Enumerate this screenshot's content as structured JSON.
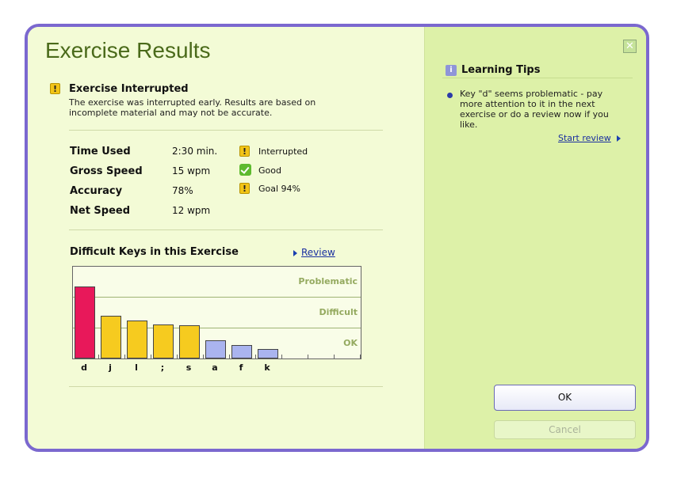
{
  "window": {
    "title": "Exercise Results"
  },
  "interrupted": {
    "title": "Exercise Interrupted",
    "description": "The exercise was interrupted early. Results are based on incomplete material and may not be accurate."
  },
  "stats": [
    {
      "label": "Time Used",
      "value": "2:30 min.",
      "icon": "warning-icon",
      "note": "Interrupted"
    },
    {
      "label": "Gross Speed",
      "value": "15 wpm",
      "icon": "check-icon",
      "note": "Good"
    },
    {
      "label": "Accuracy",
      "value": "78%",
      "icon": "warning-icon",
      "note": "Goal 94%"
    },
    {
      "label": "Net Speed",
      "value": "12 wpm",
      "icon": "",
      "note": ""
    }
  ],
  "difficult_keys": {
    "title": "Difficult Keys in this Exercise",
    "review_link": "Review"
  },
  "chart_data": {
    "type": "bar",
    "categories": [
      "d",
      "j",
      "l",
      ";",
      "s",
      "a",
      "f",
      "k"
    ],
    "values": [
      2.35,
      1.4,
      1.25,
      1.1,
      1.08,
      0.6,
      0.45,
      0.3
    ],
    "band_labels": [
      "Problematic",
      "Difficult",
      "OK"
    ],
    "ylim": [
      0,
      3
    ],
    "empty_slots": 3,
    "colors": {
      "problematic": "#e8185a",
      "difficult": "#f6cb1f",
      "ok": "#aab4ef"
    }
  },
  "tips": {
    "title": "Learning Tips",
    "text": "Key \"d\" seems problematic - pay more attention to it in the next exercise or do a review now if you like.",
    "start_review": "Start review"
  },
  "buttons": {
    "ok": "OK",
    "cancel": "Cancel"
  },
  "colors": {
    "frame": "#7b68cf",
    "title": "#4a6a1a"
  }
}
